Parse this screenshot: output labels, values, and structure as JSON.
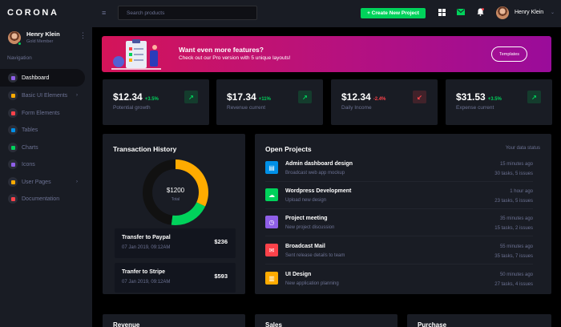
{
  "brand": "CORONA",
  "profile": {
    "name": "Henry Klein",
    "role": "Gold Member"
  },
  "nav": {
    "caption": "Navigation",
    "items": [
      {
        "label": "Dashboard",
        "icon": "speedometer-icon",
        "color": "#8f5fe8",
        "active": true
      },
      {
        "label": "Basic UI Elements",
        "icon": "laptop-icon",
        "color": "#ffab00",
        "arrow": true
      },
      {
        "label": "Form Elements",
        "icon": "playlist-icon",
        "color": "#fc424a"
      },
      {
        "label": "Tables",
        "icon": "table-icon",
        "color": "#0090e7"
      },
      {
        "label": "Charts",
        "icon": "chart-icon",
        "color": "#00d25b"
      },
      {
        "label": "Icons",
        "icon": "contacts-icon",
        "color": "#8f5fe8"
      },
      {
        "label": "User Pages",
        "icon": "security-icon",
        "color": "#ffab00",
        "arrow": true
      },
      {
        "label": "Documentation",
        "icon": "file-icon",
        "color": "#fc424a"
      }
    ]
  },
  "topbar": {
    "menu_icon": "≡",
    "search_placeholder": "Search products",
    "create_label": "+ Create New Project",
    "user_name": "Henry Klein"
  },
  "banner": {
    "title": "Want even more features?",
    "subtitle": "Check out our Pro version with 5 unique layouts!",
    "button": "Templates"
  },
  "stats": [
    {
      "value": "$12.34",
      "change": "+3.5%",
      "direction": "up",
      "label": "Potential growth"
    },
    {
      "value": "$17.34",
      "change": "+11%",
      "direction": "up",
      "label": "Revenue current"
    },
    {
      "value": "$12.34",
      "change": "-2.4%",
      "direction": "down",
      "label": "Daily Income"
    },
    {
      "value": "$31.53",
      "change": "+3.5%",
      "direction": "up",
      "label": "Expense current"
    }
  ],
  "transactions": {
    "title": "Transaction History",
    "donut_value": "$1200",
    "donut_label": "Total",
    "donut_segments": [
      {
        "color": "#ffab00",
        "fraction": 0.32
      },
      {
        "color": "#00d25b",
        "fraction": 0.2
      },
      {
        "color": "#111111",
        "fraction": 0.48
      }
    ],
    "items": [
      {
        "title": "Transfer to Paypal",
        "date": "07 Jan 2019, 09:12AM",
        "amount": "$236"
      },
      {
        "title": "Tranfer to Stripe",
        "date": "07 Jan 2019, 09:12AM",
        "amount": "$593"
      }
    ]
  },
  "projects": {
    "title": "Open Projects",
    "status": "Your data status",
    "items": [
      {
        "title": "Admin dashboard design",
        "subtitle": "Broadcast web app mockup",
        "time": "15 minutes ago",
        "tasks": "30 tasks, 5 issues",
        "color": "#0090e7",
        "icon": "file-icon",
        "glyph": "▤"
      },
      {
        "title": "Wordpress Development",
        "subtitle": "Upload new design",
        "time": "1 hour ago",
        "tasks": "23 tasks, 5 issues",
        "color": "#00d25b",
        "icon": "cloud-upload-icon",
        "glyph": "☁"
      },
      {
        "title": "Project meeting",
        "subtitle": "New project discussion",
        "time": "35 minutes ago",
        "tasks": "15 tasks, 2 issues",
        "color": "#8f5fe8",
        "icon": "clock-icon",
        "glyph": "◷"
      },
      {
        "title": "Broadcast Mail",
        "subtitle": "Sent release details to team",
        "time": "55 minutes ago",
        "tasks": "35 tasks, 7 issues",
        "color": "#fc424a",
        "icon": "mail-icon",
        "glyph": "✉"
      },
      {
        "title": "UI Design",
        "subtitle": "New application planning",
        "time": "50 minutes ago",
        "tasks": "27 tasks, 4 issues",
        "color": "#ffab00",
        "icon": "chart-icon",
        "glyph": "▥"
      }
    ]
  },
  "bottom_cards": [
    "Revenue",
    "Sales",
    "Purchase"
  ]
}
